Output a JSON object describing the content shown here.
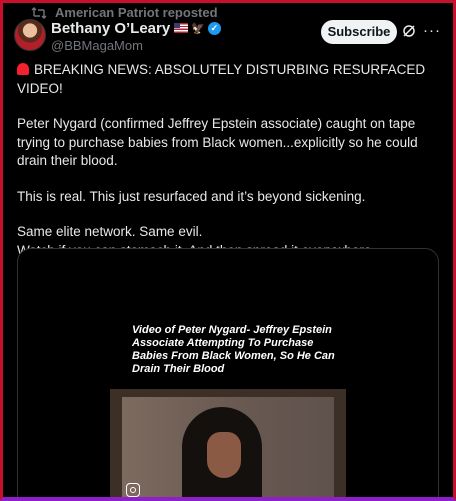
{
  "repost": {
    "label": "American Patriot reposted",
    "icon": "repost-icon"
  },
  "author": {
    "name": "Bethany O’Leary",
    "handle": "@BBMagaMom",
    "badges": [
      "us-flag-icon",
      "eagle-icon",
      "verified-badge-icon"
    ],
    "verified_color": "#1d9bf0"
  },
  "header": {
    "subscribe_label": "Subscribe",
    "grok_icon": "grok-icon",
    "more_icon": "more-icon"
  },
  "post": {
    "line1": "BREAKING NEWS: ABSOLUTELY DISTURBING RESURFACED VIDEO!",
    "line2": "Peter Nygard (confirmed Jeffrey Epstein associate) caught on tape trying to purchase babies from Black women...explicitly so he could drain their blood.",
    "line3": "This is real. This just resurfaced and it’s beyond sickening.",
    "line4a": "Same elite network. Same evil.",
    "line4b": "Watch if you can stomach it. And then spread it everywhere....."
  },
  "media": {
    "caption": "Video of Peter Nygard- Jeffrey Epstein Associate Attempting To Purchase Babies From Black Women, So He Can Drain Their Blood",
    "watermark_icon": "instagram-icon"
  },
  "colors": {
    "frame_border": "#c8102e",
    "bottom_border": "#8f1fc7",
    "muted_text": "#71767b",
    "text": "#e7e9ea"
  }
}
